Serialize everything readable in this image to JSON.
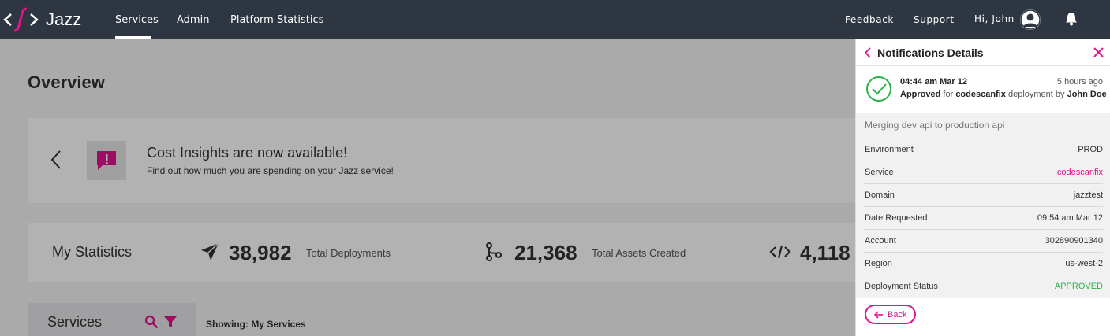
{
  "app": {
    "name": "Jazz",
    "nav": [
      "Services",
      "Admin",
      "Platform Statistics"
    ],
    "right_nav": [
      "Feedback",
      "Support",
      "Hi, John"
    ]
  },
  "overview": {
    "title": "Overview",
    "insight": {
      "title": "Cost Insights are now available!",
      "subtitle": "Find out how much you are spending on your Jazz service!"
    },
    "stats": {
      "title": "My Statistics",
      "items": [
        {
          "value": "38,982",
          "label": "Total Deployments",
          "icon": "paper-plane-icon"
        },
        {
          "value": "21,368",
          "label": "Total Assets Created",
          "icon": "branch-icon"
        },
        {
          "value": "4,118",
          "label": "",
          "icon": "code-icon"
        }
      ]
    },
    "services": {
      "title": "Services",
      "showing": "Showing: My Services"
    }
  },
  "panel": {
    "title": "Notifications Details",
    "notification": {
      "time": "04:44 am Mar 12",
      "ago": "5 hours ago",
      "status_word": "Approved",
      "for_word": "for",
      "service": "codescanfix",
      "deployment_by": "deployment by",
      "user": "John Doe"
    },
    "details_title": "Merging dev api to production api",
    "rows": [
      {
        "key": "Environment",
        "value": "PROD"
      },
      {
        "key": "Service",
        "value": "codescanfix"
      },
      {
        "key": "Domain",
        "value": "jazztest"
      },
      {
        "key": "Date Requested",
        "value": "09:54 am Mar 12"
      },
      {
        "key": "Account",
        "value": "302890901340"
      },
      {
        "key": "Region",
        "value": "us-west-2"
      },
      {
        "key": "Deployment Status",
        "value": "APPROVED"
      }
    ],
    "back_label": "Back"
  },
  "colors": {
    "accent": "#e0148c",
    "topbar": "#2e3641",
    "approved": "#2bb34a"
  }
}
